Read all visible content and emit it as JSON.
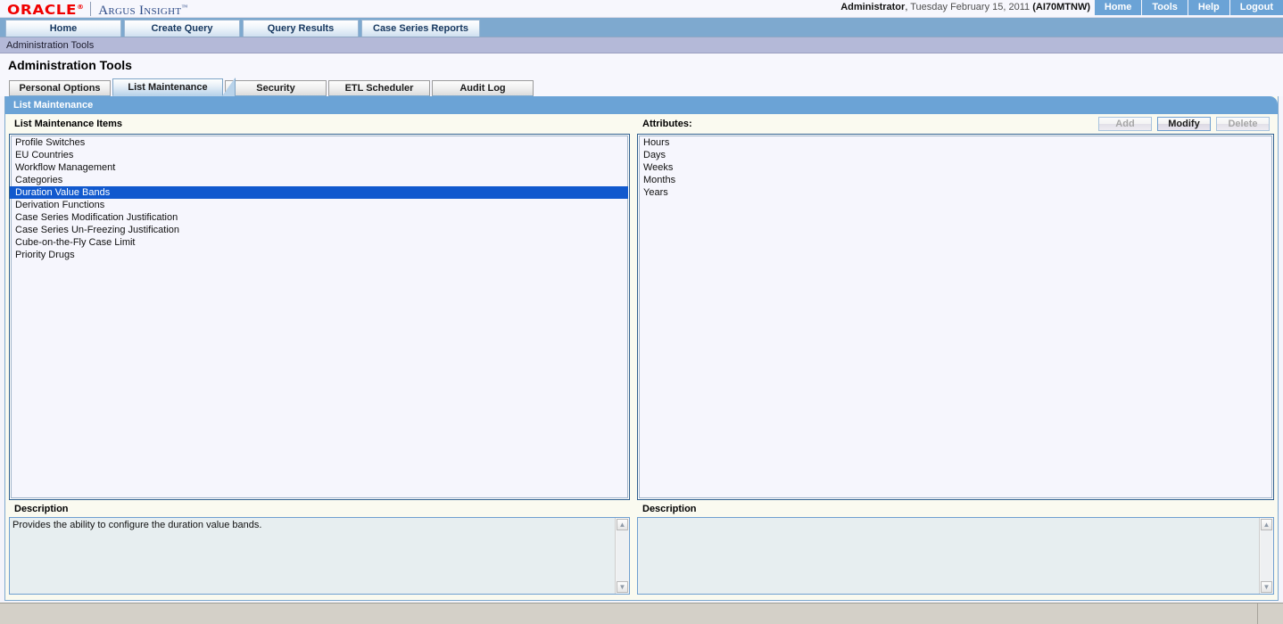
{
  "brand": {
    "oracle": "ORACLE",
    "registered": "®",
    "product": "Argus Insight",
    "tm": "™"
  },
  "header": {
    "user": "Administrator",
    "comma": ",",
    "date": "Tuesday February 15, 2011",
    "site": "(AI70MTNW)",
    "nav": [
      {
        "label": "Home",
        "name": "topnav-home"
      },
      {
        "label": "Tools",
        "name": "topnav-tools"
      },
      {
        "label": "Help",
        "name": "topnav-help"
      },
      {
        "label": "Logout",
        "name": "topnav-logout"
      }
    ]
  },
  "main_tabs": [
    {
      "label": "Home"
    },
    {
      "label": "Create Query"
    },
    {
      "label": "Query Results"
    },
    {
      "label": "Case Series Reports"
    }
  ],
  "breadcrumb": "Administration Tools",
  "page_title": "Administration Tools",
  "sub_tabs": [
    {
      "label": "Personal Options",
      "active": false
    },
    {
      "label": "List Maintenance",
      "active": true
    },
    {
      "label": "Security",
      "active": false
    },
    {
      "label": "ETL Scheduler",
      "active": false
    },
    {
      "label": "Audit Log",
      "active": false
    }
  ],
  "panel": {
    "title": "List Maintenance"
  },
  "list_panel": {
    "label": "List Maintenance Items",
    "items": [
      {
        "label": "Profile Switches",
        "selected": false
      },
      {
        "label": "EU Countries",
        "selected": false
      },
      {
        "label": "Workflow Management",
        "selected": false
      },
      {
        "label": "Categories",
        "selected": false
      },
      {
        "label": "Duration Value Bands",
        "selected": true
      },
      {
        "label": "Derivation Functions",
        "selected": false
      },
      {
        "label": "Case Series Modification Justification",
        "selected": false
      },
      {
        "label": "Case Series Un-Freezing Justification",
        "selected": false
      },
      {
        "label": "Cube-on-the-Fly Case Limit",
        "selected": false
      },
      {
        "label": "Priority Drugs",
        "selected": false
      }
    ]
  },
  "attributes_panel": {
    "label": "Attributes:",
    "buttons": [
      {
        "label": "Add",
        "disabled": true,
        "name": "add-button"
      },
      {
        "label": "Modify",
        "disabled": false,
        "name": "modify-button"
      },
      {
        "label": "Delete",
        "disabled": true,
        "name": "delete-button"
      }
    ],
    "items": [
      {
        "label": "Hours",
        "selected": false
      },
      {
        "label": "Days",
        "selected": false
      },
      {
        "label": "Weeks",
        "selected": false
      },
      {
        "label": "Months",
        "selected": false
      },
      {
        "label": "Years",
        "selected": false
      }
    ]
  },
  "description_left": {
    "label": "Description",
    "value": "Provides the ability to configure the duration value bands."
  },
  "description_right": {
    "label": "Description",
    "value": ""
  },
  "colors": {
    "oracle_red": "#f00000",
    "brand_blue": "#2c4a86",
    "panel_header_blue": "#6ba3d6",
    "tabbar_blue": "#7ea9cf",
    "breadcrumb_lavender": "#b4b9d8",
    "selection_blue": "#1159ce",
    "panel_bg": "#fafaf0",
    "list_bg": "#f6f6fd",
    "desc_bg": "#e7eef0",
    "statusbar": "#d4d0c8"
  }
}
